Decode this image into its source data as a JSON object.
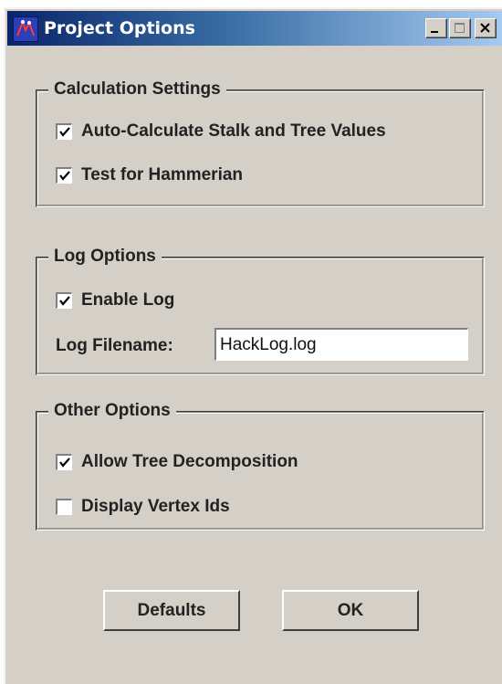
{
  "window": {
    "title": "Project Options",
    "controls": {
      "minimize": "minimize",
      "maximize": "maximize",
      "close": "close"
    }
  },
  "groups": {
    "calculation": {
      "title": "Calculation Settings",
      "options": [
        {
          "label": "Auto-Calculate Stalk and Tree Values",
          "checked": true
        },
        {
          "label": "Test for Hammerian",
          "checked": true
        }
      ]
    },
    "log": {
      "title": "Log Options",
      "options": [
        {
          "label": "Enable Log",
          "checked": true
        }
      ],
      "filename_label": "Log Filename:",
      "filename_value": "HackLog.log"
    },
    "other": {
      "title": "Other Options",
      "options": [
        {
          "label": "Allow Tree Decomposition",
          "checked": true
        },
        {
          "label": "Display Vertex Ids",
          "checked": false
        }
      ]
    }
  },
  "buttons": {
    "defaults": "Defaults",
    "ok": "OK"
  },
  "colors": {
    "window_bg": "#d4d0c8",
    "title_gradient_start": "#0a246a",
    "title_gradient_end": "#a6caf0"
  }
}
